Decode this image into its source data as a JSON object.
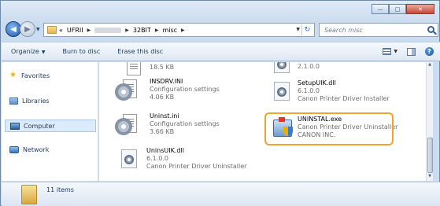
{
  "window": {
    "caption_buttons": {
      "minimize": "—",
      "maximize": "□",
      "close": "✕"
    }
  },
  "address_bar": {
    "prefix": "«",
    "crumbs": [
      "UFRII",
      "32BIT",
      "misc"
    ],
    "search_placeholder": "Search misc"
  },
  "toolbar": {
    "organize": "Organize",
    "burn": "Burn to disc",
    "erase": "Erase this disc"
  },
  "nav_pane": {
    "items": [
      {
        "label": "Favorites",
        "icon": "star-icon"
      },
      {
        "label": "Libraries",
        "icon": "libraries-icon"
      },
      {
        "label": "Computer",
        "icon": "computer-icon"
      },
      {
        "label": "Network",
        "icon": "network-icon"
      }
    ]
  },
  "files": [
    {
      "name": "",
      "line2": "18.5 KB",
      "line3": "",
      "icon": "document-icon"
    },
    {
      "name": "",
      "line2": "2.1.0.0",
      "line3": "",
      "icon": "dll-icon"
    },
    {
      "name": "INSDRV.INI",
      "line2": "Configuration settings",
      "line3": "4.06 KB",
      "icon": "ini-settings-icon"
    },
    {
      "name": "SetupUIK.dll",
      "line2": "6.1.0.0",
      "line3": "Canon Printer Driver Installer",
      "icon": "dll-icon"
    },
    {
      "name": "Uninst.ini",
      "line2": "Configuration settings",
      "line3": "3.66 KB",
      "icon": "ini-settings-icon"
    },
    {
      "name": "UNINSTAL.exe",
      "line2": "Canon Printer Driver Uninstaller",
      "line3": "CANON INC.",
      "icon": "installer-exe-icon"
    },
    {
      "name": "UninsUIK.dll",
      "line2": "6.1.0.0",
      "line3": "Canon Printer Driver Uninstaller",
      "icon": "dll-icon"
    }
  ],
  "details_pane": {
    "item_count": "11 items"
  },
  "colors": {
    "highlight": "#f0a331",
    "selected_nav": "#dcebfb"
  }
}
